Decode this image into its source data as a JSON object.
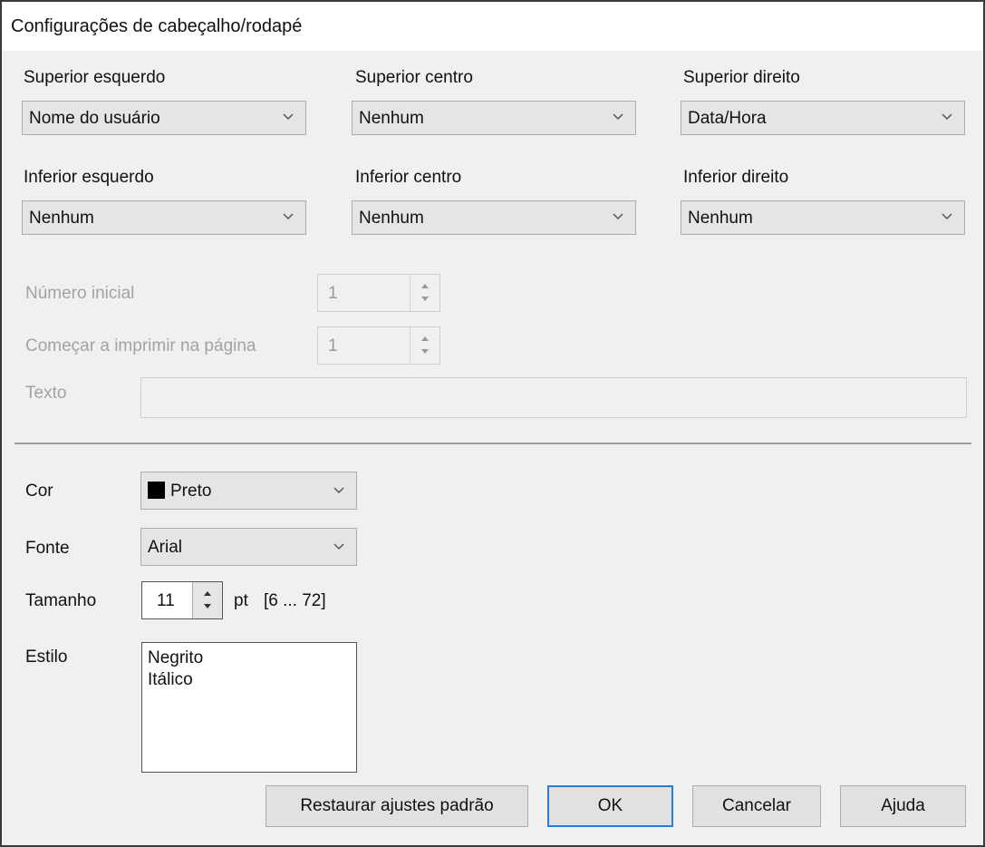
{
  "window": {
    "title": "Configurações de cabeçalho/rodapé"
  },
  "positions": {
    "top_left": {
      "label": "Superior esquerdo",
      "value": "Nome do usuário"
    },
    "top_center": {
      "label": "Superior centro",
      "value": "Nenhum"
    },
    "top_right": {
      "label": "Superior direito",
      "value": "Data/Hora"
    },
    "bottom_left": {
      "label": "Inferior esquerdo",
      "value": "Nenhum"
    },
    "bottom_center": {
      "label": "Inferior centro",
      "value": "Nenhum"
    },
    "bottom_right": {
      "label": "Inferior direito",
      "value": "Nenhum"
    }
  },
  "numbering": {
    "start_number": {
      "label": "Número inicial",
      "value": "1"
    },
    "start_page": {
      "label": "Começar a imprimir na página",
      "value": "1"
    },
    "text": {
      "label": "Texto",
      "value": ""
    }
  },
  "font": {
    "color": {
      "label": "Cor",
      "value": "Preto",
      "swatch": "#000000"
    },
    "face": {
      "label": "Fonte",
      "value": "Arial"
    },
    "size": {
      "label": "Tamanho",
      "value": "11",
      "unit": "pt",
      "range": "[6 ... 72]"
    },
    "style": {
      "label": "Estilo",
      "options": [
        "Negrito",
        "Itálico"
      ]
    }
  },
  "buttons": {
    "restore": "Restaurar ajustes padrão",
    "ok": "OK",
    "cancel": "Cancelar",
    "help": "Ajuda"
  },
  "colors": {
    "default_button_border": "#2d7bd3",
    "disabled_text": "#a3a3a3"
  }
}
